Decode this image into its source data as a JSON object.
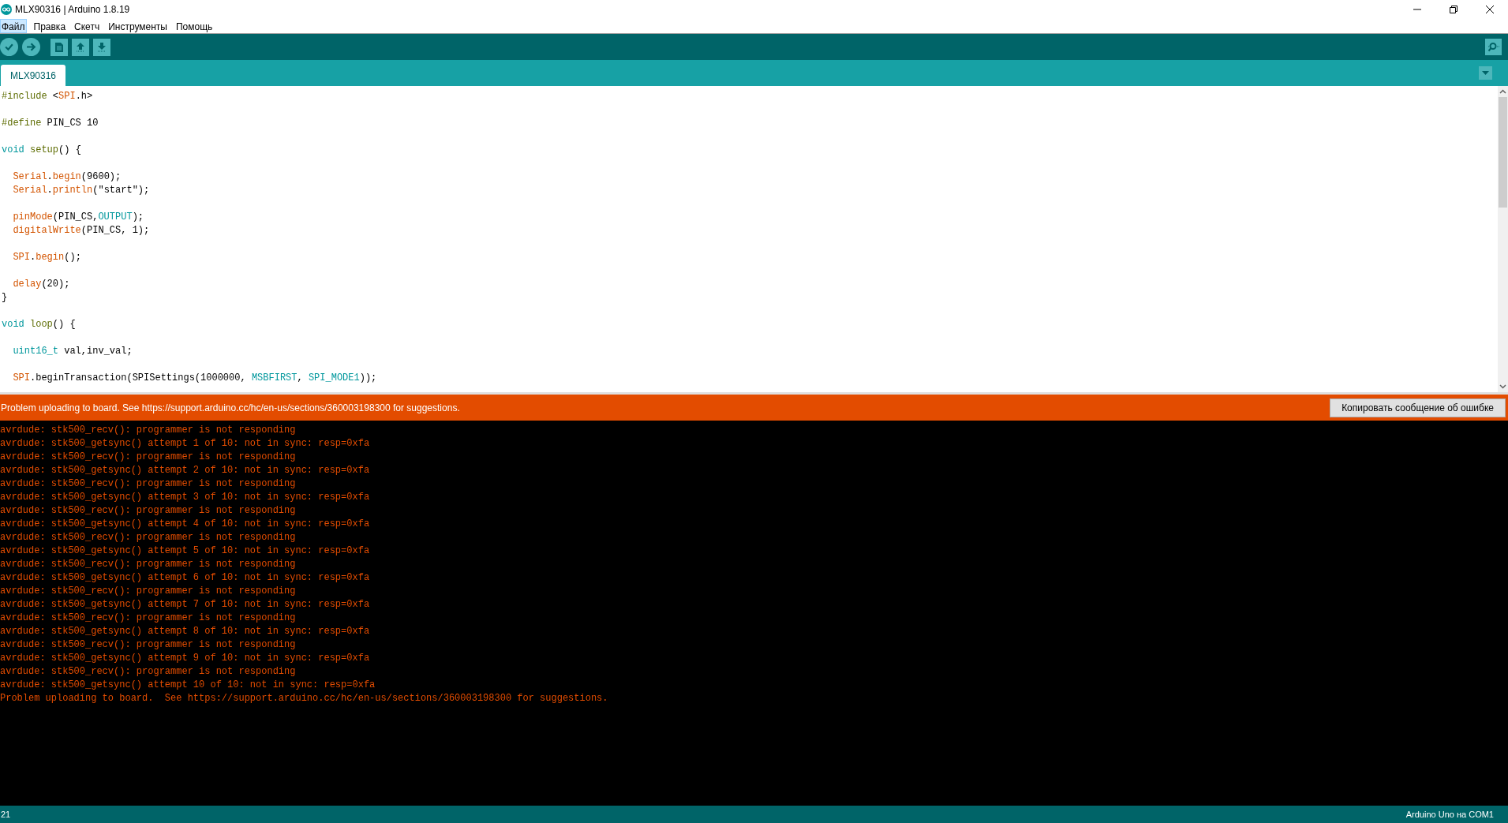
{
  "window": {
    "title": "MLX90316 | Arduino 1.8.19"
  },
  "menu": [
    {
      "label": "Файл",
      "selected": true
    },
    {
      "label": "Правка",
      "selected": false
    },
    {
      "label": "Скетч",
      "selected": false
    },
    {
      "label": "Инструменты",
      "selected": false
    },
    {
      "label": "Помощь",
      "selected": false
    }
  ],
  "toolbar": [
    {
      "kind": "verify"
    },
    {
      "kind": "upload"
    },
    {
      "kind": "new"
    },
    {
      "kind": "open"
    },
    {
      "kind": "save"
    }
  ],
  "tabs": [
    {
      "label": "MLX90316",
      "selected": true
    }
  ],
  "code": [
    {
      "kind": "code",
      "segments": [
        {
          "text": "#include ",
          "kind": "preproc"
        },
        {
          "text": "<",
          "kind": "plain"
        },
        {
          "text": "SPI",
          "kind": "function"
        },
        {
          "text": ".h>",
          "kind": "plain"
        }
      ]
    },
    {
      "kind": "blank"
    },
    {
      "kind": "code",
      "segments": [
        {
          "text": "#define ",
          "kind": "preproc"
        },
        {
          "text": "PIN_CS 10",
          "kind": "plain"
        }
      ]
    },
    {
      "kind": "blank"
    },
    {
      "kind": "code",
      "segments": [
        {
          "text": "void ",
          "kind": "keyword"
        },
        {
          "text": "setup",
          "kind": "preproc"
        },
        {
          "text": "() {",
          "kind": "plain"
        }
      ]
    },
    {
      "kind": "blank"
    },
    {
      "kind": "code",
      "segments": [
        {
          "text": "  Serial",
          "kind": "function"
        },
        {
          "text": ".",
          "kind": "plain"
        },
        {
          "text": "begin",
          "kind": "function"
        },
        {
          "text": "(9600);",
          "kind": "plain"
        }
      ]
    },
    {
      "kind": "code",
      "segments": [
        {
          "text": "  Serial",
          "kind": "function"
        },
        {
          "text": ".",
          "kind": "plain"
        },
        {
          "text": "println",
          "kind": "function"
        },
        {
          "text": "(\"start\");",
          "kind": "plain"
        }
      ]
    },
    {
      "kind": "blank"
    },
    {
      "kind": "code",
      "segments": [
        {
          "text": "  pinMode",
          "kind": "function"
        },
        {
          "text": "(PIN_CS,",
          "kind": "plain"
        },
        {
          "text": "OUTPUT",
          "kind": "keyword"
        },
        {
          "text": ");",
          "kind": "plain"
        }
      ]
    },
    {
      "kind": "code",
      "segments": [
        {
          "text": "  digitalWrite",
          "kind": "function"
        },
        {
          "text": "(PIN_CS, 1);",
          "kind": "plain"
        }
      ]
    },
    {
      "kind": "blank"
    },
    {
      "kind": "code",
      "segments": [
        {
          "text": "  SPI",
          "kind": "function"
        },
        {
          "text": ".",
          "kind": "plain"
        },
        {
          "text": "begin",
          "kind": "function"
        },
        {
          "text": "();",
          "kind": "plain"
        }
      ]
    },
    {
      "kind": "blank"
    },
    {
      "kind": "code",
      "segments": [
        {
          "text": "  delay",
          "kind": "function"
        },
        {
          "text": "(20);",
          "kind": "plain"
        }
      ]
    },
    {
      "kind": "code",
      "segments": [
        {
          "text": "}",
          "kind": "plain"
        }
      ]
    },
    {
      "kind": "blank"
    },
    {
      "kind": "code",
      "segments": [
        {
          "text": "void ",
          "kind": "keyword"
        },
        {
          "text": "loop",
          "kind": "preproc"
        },
        {
          "text": "() {",
          "kind": "plain"
        }
      ]
    },
    {
      "kind": "blank"
    },
    {
      "kind": "code",
      "segments": [
        {
          "text": "  uint16_t ",
          "kind": "keyword"
        },
        {
          "text": "val,inv_val;",
          "kind": "plain"
        }
      ]
    },
    {
      "kind": "blank"
    },
    {
      "kind": "code",
      "segments": [
        {
          "text": "  SPI",
          "kind": "function"
        },
        {
          "text": ".beginTransaction(SPISettings(1000000, ",
          "kind": "plain"
        },
        {
          "text": "MSBFIRST",
          "kind": "keyword"
        },
        {
          "text": ", ",
          "kind": "plain"
        },
        {
          "text": "SPI_MODE1",
          "kind": "keyword"
        },
        {
          "text": "));",
          "kind": "plain"
        }
      ]
    }
  ],
  "error_bar": {
    "message": "Problem uploading to board.  See https://support.arduino.cc/hc/en-us/sections/360003198300 for suggestions.",
    "button": "Копировать сообщение об ошибке"
  },
  "console": [
    "avrdude: stk500_recv(): programmer is not responding",
    "avrdude: stk500_getsync() attempt 1 of 10: not in sync: resp=0xfa",
    "avrdude: stk500_recv(): programmer is not responding",
    "avrdude: stk500_getsync() attempt 2 of 10: not in sync: resp=0xfa",
    "avrdude: stk500_recv(): programmer is not responding",
    "avrdude: stk500_getsync() attempt 3 of 10: not in sync: resp=0xfa",
    "avrdude: stk500_recv(): programmer is not responding",
    "avrdude: stk500_getsync() attempt 4 of 10: not in sync: resp=0xfa",
    "avrdude: stk500_recv(): programmer is not responding",
    "avrdude: stk500_getsync() attempt 5 of 10: not in sync: resp=0xfa",
    "avrdude: stk500_recv(): programmer is not responding",
    "avrdude: stk500_getsync() attempt 6 of 10: not in sync: resp=0xfa",
    "avrdude: stk500_recv(): programmer is not responding",
    "avrdude: stk500_getsync() attempt 7 of 10: not in sync: resp=0xfa",
    "avrdude: stk500_recv(): programmer is not responding",
    "avrdude: stk500_getsync() attempt 8 of 10: not in sync: resp=0xfa",
    "avrdude: stk500_recv(): programmer is not responding",
    "avrdude: stk500_getsync() attempt 9 of 10: not in sync: resp=0xfa",
    "avrdude: stk500_recv(): programmer is not responding",
    "avrdude: stk500_getsync() attempt 10 of 10: not in sync: resp=0xfa",
    "Problem uploading to board.  See https://support.arduino.cc/hc/en-us/sections/360003198300 for suggestions."
  ],
  "status_bar": {
    "line": "21",
    "board": "Arduino Uno на COM1"
  }
}
